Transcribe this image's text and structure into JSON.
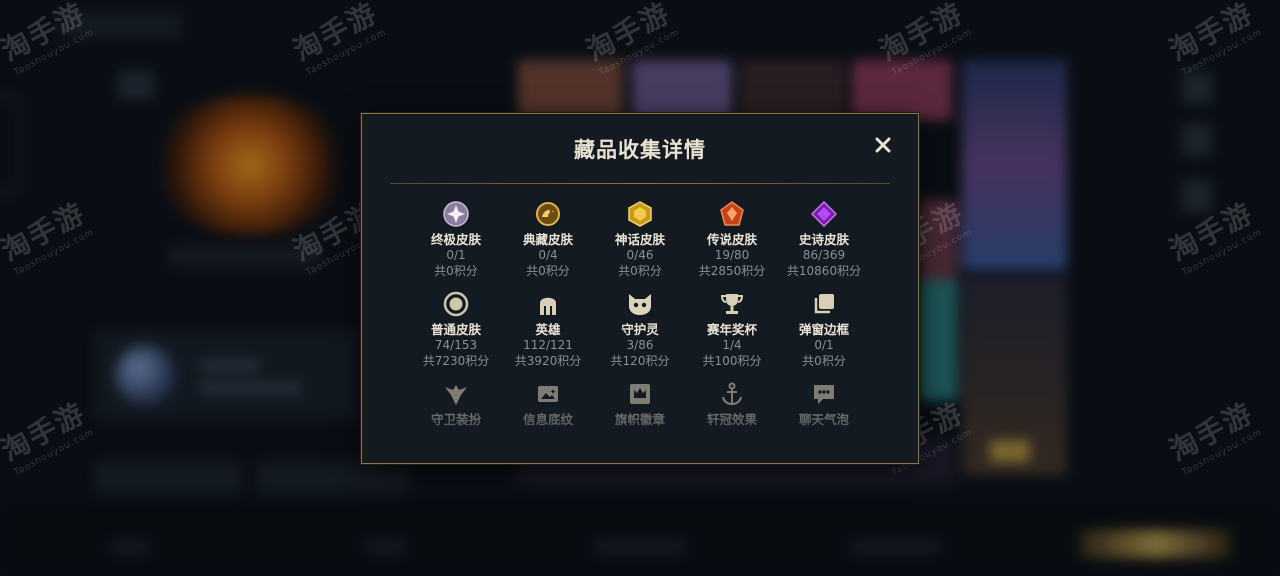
{
  "modal": {
    "title": "藏品收集详情",
    "close_icon": "close-icon"
  },
  "collection": {
    "rows": [
      [
        {
          "icon": "ultimate-skin-icon",
          "name": "终极皮肤",
          "count": "0/1",
          "points": "共0积分"
        },
        {
          "icon": "prestige-skin-icon",
          "name": "典藏皮肤",
          "count": "0/4",
          "points": "共0积分"
        },
        {
          "icon": "mythic-skin-icon",
          "name": "神话皮肤",
          "count": "0/46",
          "points": "共0积分"
        },
        {
          "icon": "legendary-skin-icon",
          "name": "传说皮肤",
          "count": "19/80",
          "points": "共2850积分"
        },
        {
          "icon": "epic-skin-icon",
          "name": "史诗皮肤",
          "count": "86/369",
          "points": "共10860积分"
        }
      ],
      [
        {
          "icon": "standard-skin-icon",
          "name": "普通皮肤",
          "count": "74/153",
          "points": "共7230积分"
        },
        {
          "icon": "champion-helmet-icon",
          "name": "英雄",
          "count": "112/121",
          "points": "共3920积分"
        },
        {
          "icon": "companion-icon",
          "name": "守护灵",
          "count": "3/86",
          "points": "共120积分"
        },
        {
          "icon": "trophy-icon",
          "name": "赛年奖杯",
          "count": "1/4",
          "points": "共100积分"
        },
        {
          "icon": "frame-icon",
          "name": "弹窗边框",
          "count": "0/1",
          "points": "共0积分"
        }
      ],
      [
        {
          "icon": "ward-skin-icon",
          "name": "守卫装扮"
        },
        {
          "icon": "banner-icon",
          "name": "信息底纹"
        },
        {
          "icon": "crown-banner-icon",
          "name": "旗帜徽章"
        },
        {
          "icon": "anchor-effect-icon",
          "name": "轩冠效果"
        },
        {
          "icon": "chat-bubble-icon",
          "name": "聊天气泡"
        }
      ]
    ]
  },
  "watermark": {
    "text": "淘手游",
    "subtext": "Taoshouyou.com"
  },
  "colors": {
    "gold_border": "#8a7442",
    "modal_bg": "#141a21",
    "title": "#e8e2d2",
    "secondary_text": "#8a8f96"
  }
}
